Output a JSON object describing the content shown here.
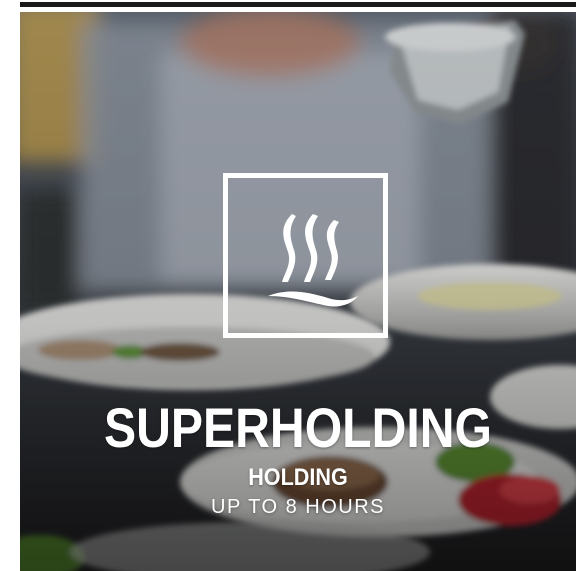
{
  "hero": {
    "title": "SUPERHOLDING",
    "subtitle": "HOLDING",
    "duration": "UP TO 8 HOURS"
  },
  "icons": {
    "logo": "steam-icon"
  },
  "colors": {
    "text": "#ffffff",
    "top_bar": "#1a1a1a",
    "logo_stroke": "#ffffff"
  }
}
